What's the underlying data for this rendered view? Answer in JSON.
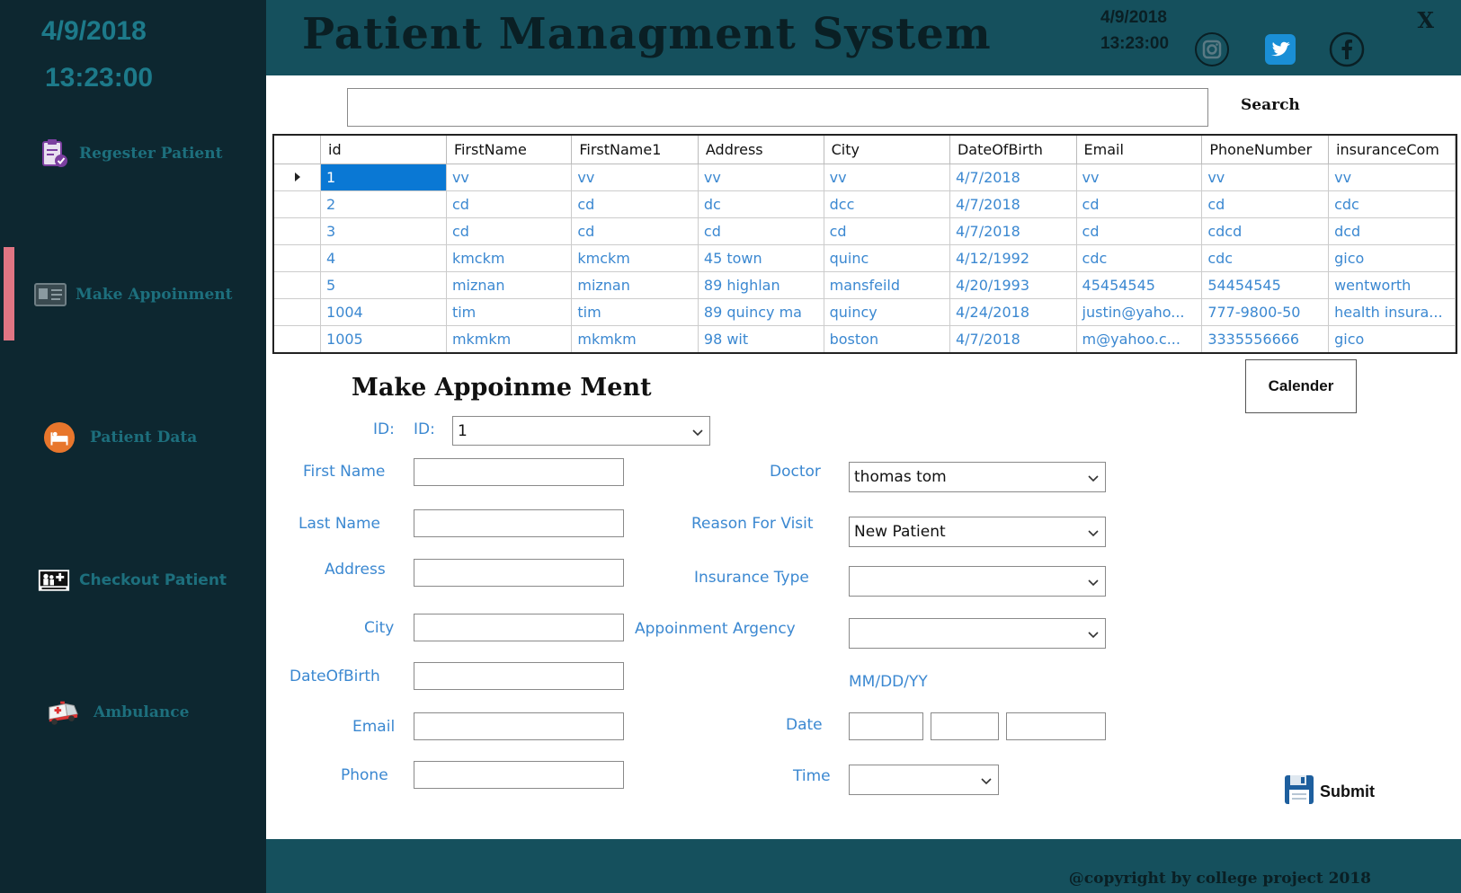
{
  "sidebar": {
    "date": "4/9/2018",
    "time": "13:23:00",
    "items": [
      {
        "label": "Regester Patient",
        "icon": "clipboard-check-icon"
      },
      {
        "label": "Make Appoinment",
        "icon": "id-card-icon"
      },
      {
        "label": "Patient Data",
        "icon": "hospital-bed-icon"
      },
      {
        "label": "Checkout Patient",
        "icon": "health-care-icon"
      },
      {
        "label": "Ambulance",
        "icon": "ambulance-icon"
      }
    ],
    "active_color": "#e07583"
  },
  "header": {
    "title": "Patient Managment System",
    "date": "4/9/2018",
    "time": "13:23:00",
    "close": "X",
    "social": [
      "instagram-icon",
      "twitter-icon",
      "facebook-icon"
    ]
  },
  "search": {
    "value": "",
    "button_label": "Search"
  },
  "grid": {
    "columns": [
      "id",
      "FirstName",
      "FirstName1",
      "Address",
      "City",
      "DateOfBirth",
      "Email",
      "PhoneNumber",
      "insuranceCom"
    ],
    "rows": [
      [
        "1",
        "vv",
        "vv",
        "vv",
        "vv",
        "4/7/2018",
        "vv",
        "vv",
        "vv"
      ],
      [
        "2",
        "cd",
        "cd",
        "dc",
        "dcc",
        "4/7/2018",
        "cd",
        "cd",
        "cdc"
      ],
      [
        "3",
        "cd",
        "cd",
        "cd",
        "cd",
        "4/7/2018",
        "cd",
        "cdcd",
        "dcd"
      ],
      [
        "4",
        "kmckm",
        "kmckm",
        "45 town",
        "quinc",
        "4/12/1992",
        "cdc",
        "cdc",
        "gico"
      ],
      [
        "5",
        "miznan",
        "miznan",
        "89 highlan",
        "mansfeild",
        "4/20/1993",
        "45454545",
        "54454545",
        "wentworth"
      ],
      [
        "1004",
        "tim",
        "tim",
        "89 quincy ma",
        "quincy",
        "4/24/2018",
        "justin@yaho...",
        "777-9800-50",
        "health insura..."
      ],
      [
        "1005",
        "mkmkm",
        "mkmkm",
        "98 wit",
        "boston",
        "4/7/2018",
        "m@yahoo.c...",
        "3335556666",
        "gico"
      ]
    ],
    "selected_row": 0
  },
  "form": {
    "title": "Make Appoinme Ment",
    "calendar_label": "Calender",
    "id_label_outer": "ID:",
    "id_label_inner": "ID:",
    "id_value": "1",
    "first_name_label": "First Name",
    "last_name_label": "Last Name",
    "address_label": "Address",
    "city_label": "City",
    "dob_label": "DateOfBirth",
    "email_label": "Email",
    "phone_label": "Phone",
    "doctor_label": "Doctor",
    "doctor_value": "thomas tom",
    "reason_label": "Reason For Visit",
    "reason_value": "New Patient",
    "insurance_label": "Insurance Type",
    "insurance_value": "",
    "urgency_label": "Appoinment Argency",
    "urgency_value": "",
    "date_format_hint": "MM/DD/YY",
    "date_label": "Date",
    "time_label": "Time",
    "time_value": "",
    "submit_label": "Submit"
  },
  "footer": {
    "copyright": "@copyright by college project 2018"
  },
  "colors": {
    "sidebar_bg": "#0d2730",
    "header_bg": "#15505d",
    "label_blue": "#3b88d1",
    "selection_blue": "#0a78d4"
  }
}
